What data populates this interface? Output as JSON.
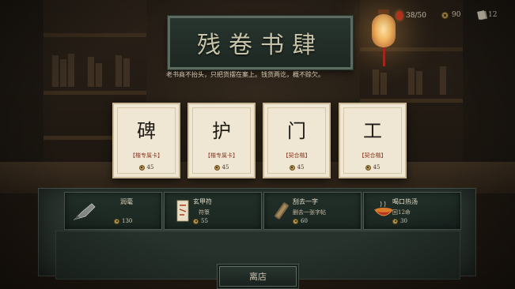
{
  "shop": {
    "title": "残卷书肆",
    "shopkeeper_line": "老书商不抬头，只把货摆在案上。钱货两讫，概不赊欠。",
    "leave_label": "离店"
  },
  "resources": {
    "health": "38/50",
    "coins": "90",
    "cards": "12"
  },
  "cards": [
    {
      "glyph": "碑",
      "tag": "【楷专属卡】",
      "price": "45"
    },
    {
      "glyph": "护",
      "tag": "【楷专属卡】",
      "price": "45"
    },
    {
      "glyph": "门",
      "tag": "【契合楷】",
      "price": "45"
    },
    {
      "glyph": "工",
      "tag": "【契合楷】",
      "price": "45"
    }
  ],
  "items": [
    {
      "name": "润毫",
      "desc": "",
      "price": "130",
      "icon": "brush-icon"
    },
    {
      "name": "玄甲符",
      "desc": "符箓",
      "price": "55",
      "icon": "talisman-icon"
    },
    {
      "name": "刮去一字",
      "desc": "删去一张字帖",
      "price": "60",
      "icon": "scroll-icon"
    },
    {
      "name": "喝口热汤",
      "desc": "回12命",
      "price": "30",
      "icon": "soup-bowl-icon"
    }
  ],
  "colors": {
    "accent_red": "#8a3a24",
    "card_bg": "#efe7d3",
    "mat": "#2f3a33"
  }
}
